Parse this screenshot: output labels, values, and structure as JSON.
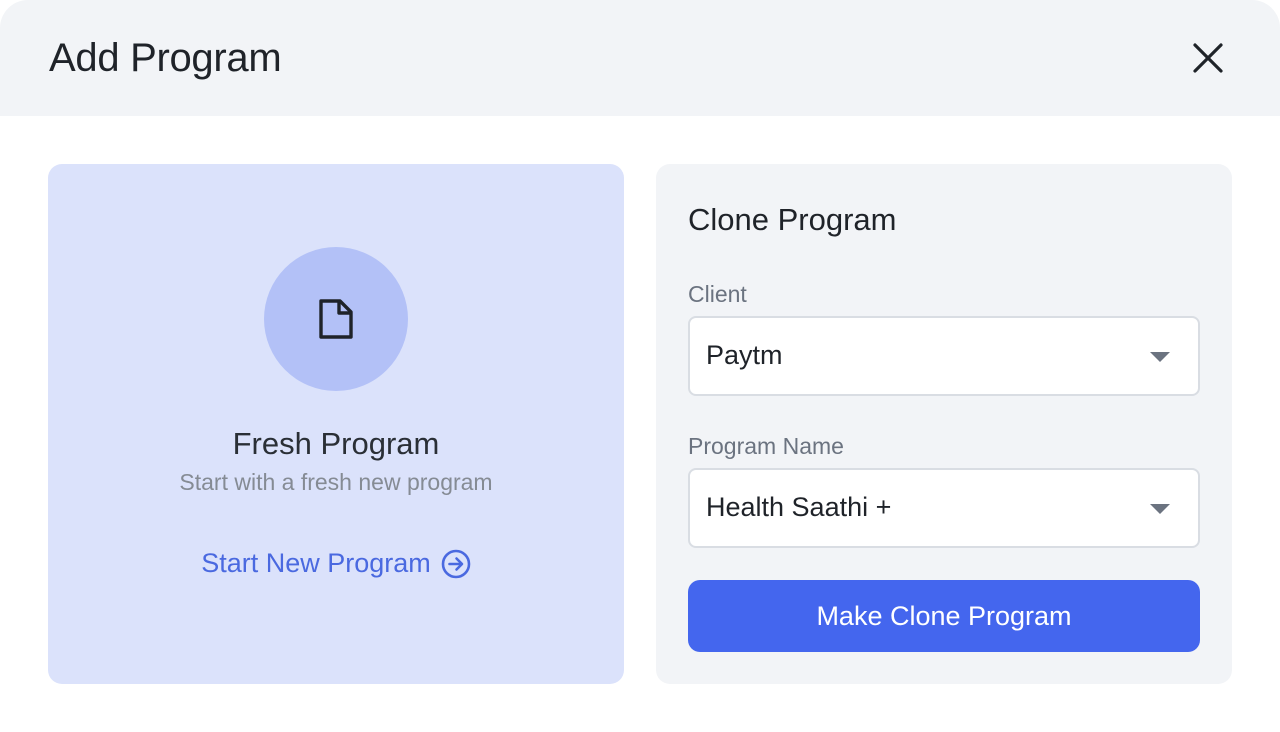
{
  "modal": {
    "title": "Add Program"
  },
  "fresh": {
    "title": "Fresh Program",
    "subtitle": "Start with a fresh new program",
    "link_label": "Start New Program",
    "icon": "file-icon",
    "link_icon": "arrow-right-circle-icon"
  },
  "clone": {
    "title": "Clone Program",
    "client_label": "Client",
    "client_value": "Paytm",
    "program_label": "Program Name",
    "program_value": "Health Saathi +",
    "button_label": "Make Clone Program"
  },
  "colors": {
    "accent": "#4466ee",
    "link": "#4a69e0",
    "fresh_card_bg": "#dbe2fb",
    "icon_circle": "#b3c1f7",
    "header_bg": "#f2f4f7"
  }
}
